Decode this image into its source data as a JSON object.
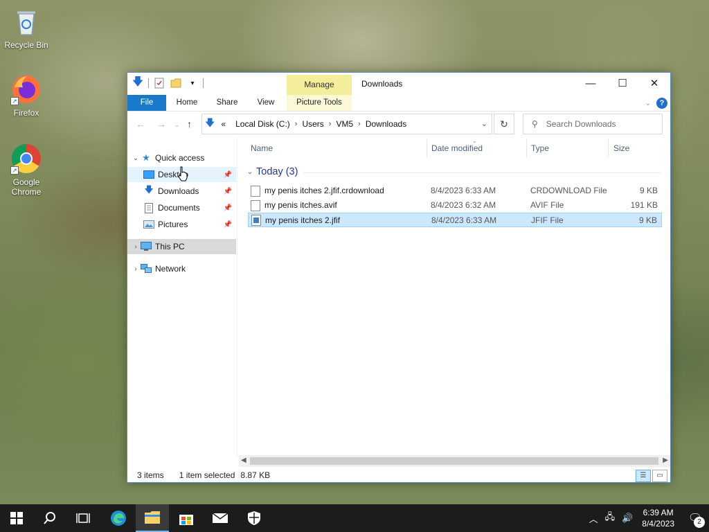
{
  "desktop": {
    "icons": [
      {
        "label": "Recycle Bin"
      },
      {
        "label": "Firefox"
      },
      {
        "label": "Google Chrome"
      }
    ]
  },
  "window": {
    "title": "Downloads",
    "manage_tab": "Manage",
    "ribbon_tabs": {
      "file": "File",
      "home": "Home",
      "share": "Share",
      "view": "View",
      "picture_tools": "Picture Tools"
    },
    "address": {
      "overflow": "«",
      "crumbs": [
        "Local Disk (C:)",
        "Users",
        "VM5",
        "Downloads"
      ]
    },
    "search": {
      "placeholder": "Search Downloads"
    },
    "nav": {
      "quick_access": "Quick access",
      "desktop": "Desktop",
      "downloads": "Downloads",
      "documents": "Documents",
      "pictures": "Pictures",
      "this_pc": "This PC",
      "network": "Network"
    },
    "columns": {
      "name": "Name",
      "date": "Date modified",
      "type": "Type",
      "size": "Size"
    },
    "group": {
      "label": "Today (3)"
    },
    "files": [
      {
        "name": "my penis itches 2.jfif.crdownload",
        "date": "8/4/2023 6:33 AM",
        "type": "CRDOWNLOAD File",
        "size": "9 KB"
      },
      {
        "name": "my penis itches.avif",
        "date": "8/4/2023 6:32 AM",
        "type": "AVIF File",
        "size": "191 KB"
      },
      {
        "name": "my penis itches 2.jfif",
        "date": "8/4/2023 6:33 AM",
        "type": "JFIF File",
        "size": "9 KB"
      }
    ],
    "status": {
      "items": "3 items",
      "selected": "1 item selected",
      "size": "8.87 KB"
    }
  },
  "taskbar": {
    "time": "6:39 AM",
    "date": "8/4/2023",
    "notifications": "2"
  },
  "colors": {
    "accent": "#1979ca",
    "manage_tab": "#f4ee9c",
    "selection": "#cce8ff"
  }
}
